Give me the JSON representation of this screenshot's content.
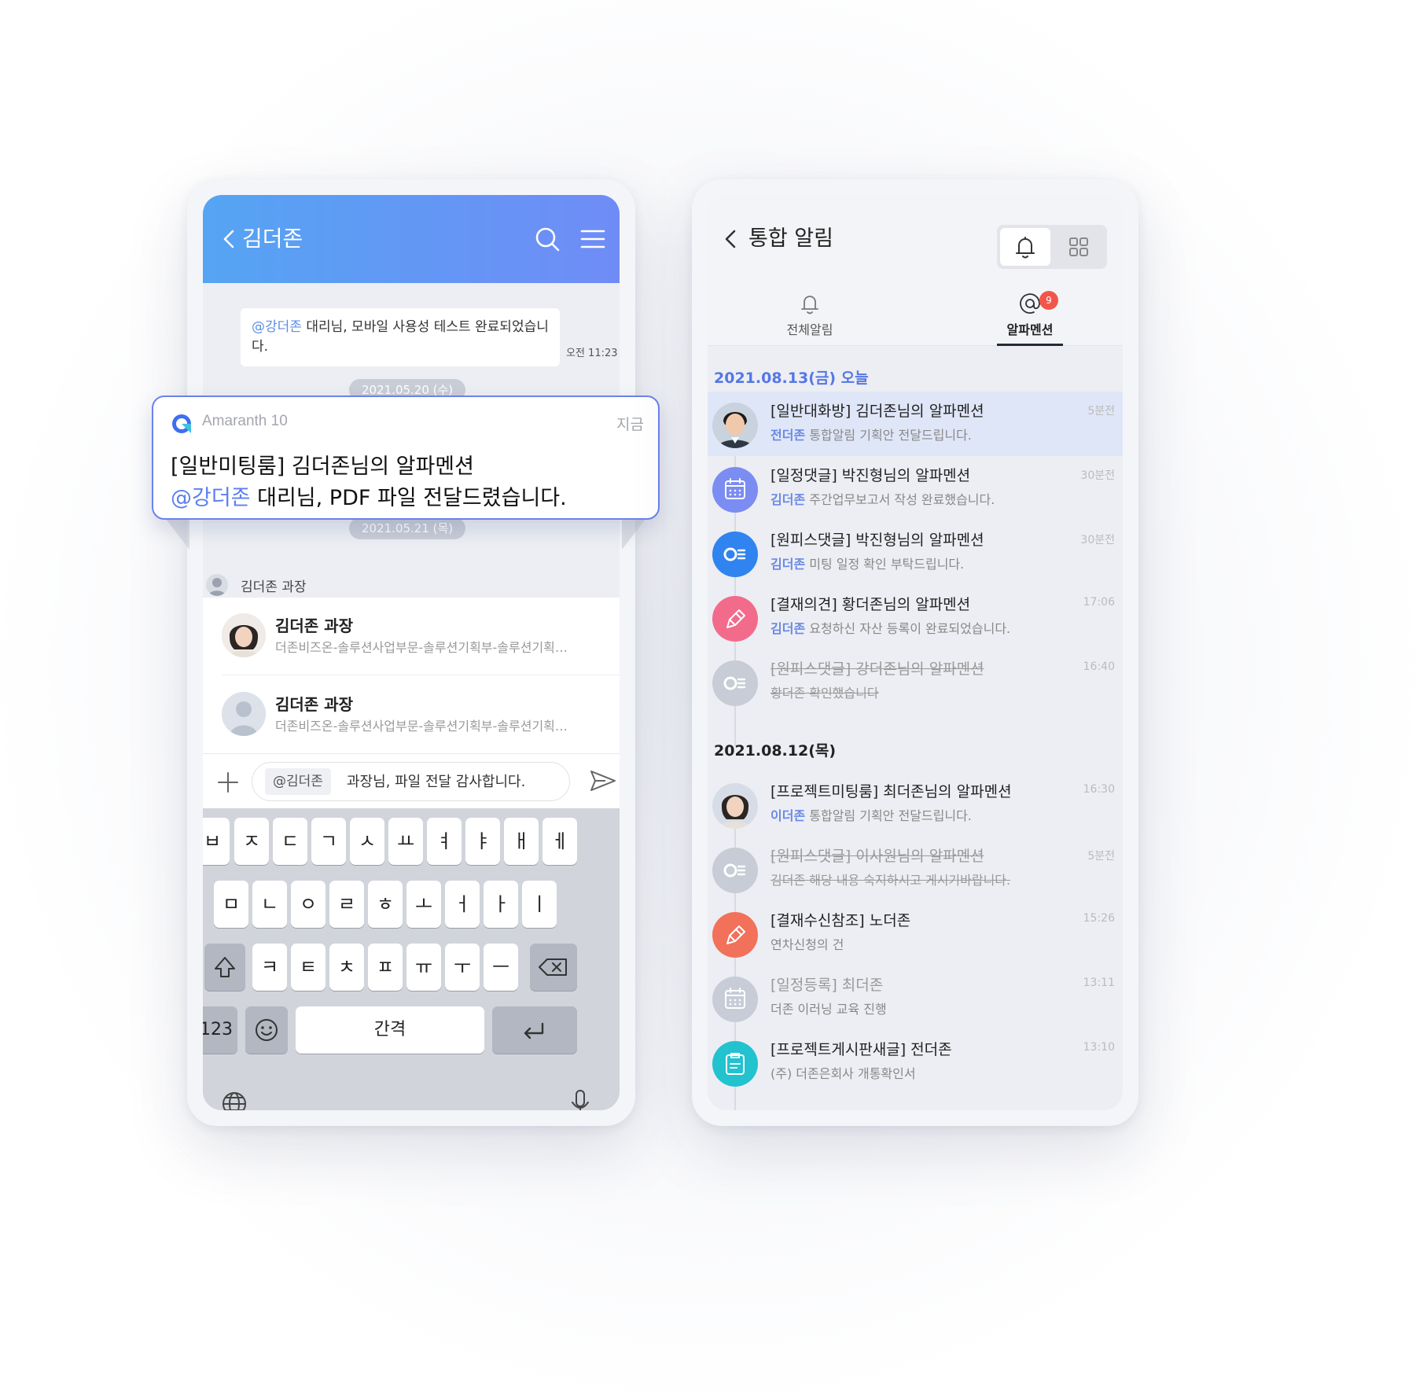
{
  "chat": {
    "title": "김더존",
    "message": {
      "mention": "@강더존",
      "text": " 대리님, 모바일 사용성 테스트 완료되었습니다.",
      "time": "오전 11:23"
    },
    "date_pill_1": "2021.05.20 (수)",
    "date_pill_2": "2021.05.21 (목)",
    "sender": "김더존 과장",
    "suggestions": [
      {
        "name": "김더존 과장",
        "dept": "더존비즈온-솔루션사업부문-솔루션기획부-솔루션기획…"
      },
      {
        "name": "김더존 과장",
        "dept": "더존비즈온-솔루션사업부문-솔루션기획부-솔루션기획…"
      }
    ],
    "input": {
      "mention_tag": "@김더존",
      "text": "과장님, 파일 전달 감사합니다."
    },
    "keyboard": {
      "row1": [
        "ㅂ",
        "ㅈ",
        "ㄷ",
        "ㄱ",
        "ㅅ",
        "ㅛ",
        "ㅕ",
        "ㅑ",
        "ㅐ",
        "ㅔ"
      ],
      "row2": [
        "ㅁ",
        "ㄴ",
        "ㅇ",
        "ㄹ",
        "ㅎ",
        "ㅗ",
        "ㅓ",
        "ㅏ",
        "ㅣ"
      ],
      "row3": [
        "ㅋ",
        "ㅌ",
        "ㅊ",
        "ㅍ",
        "ㅠ",
        "ㅜ",
        "ㅡ"
      ],
      "numbers_key": "123",
      "space_key": "간격"
    }
  },
  "notification": {
    "app": "Amaranth 10",
    "time": "지금",
    "title": "[일반미팅룸] 김더존님의 알파멘션",
    "mention": "@강더존",
    "body": " 대리님, PDF 파일 전달드렸습니다."
  },
  "inbox": {
    "title": "통합 알림",
    "tabs": [
      {
        "label": "전체알림"
      },
      {
        "label": "알파멘션",
        "badge": "9"
      }
    ],
    "groups": [
      {
        "date": "2021.08.13(금) 오늘",
        "items": [
          {
            "title": "[일반대화방] 김더존님의 알파멘션",
            "who": "전더존",
            "text": " 통합알림 기획안 전달드립니다.",
            "time": "5분전"
          },
          {
            "title": "[일정댓글] 박진형님의 알파멘션",
            "who": "김더존",
            "text": " 주간업무보고서 작성 완료했습니다.",
            "time": "30분전"
          },
          {
            "title": "[원피스댓글] 박진형님의 알파멘션",
            "who": "김더존",
            "text": " 미팅 일정 확인 부탁드립니다.",
            "time": "30분전"
          },
          {
            "title": "[결재의견] 황더존님의 알파멘션",
            "who": "김더존",
            "text": " 요청하신 자산 등록이 완료되었습니다.",
            "time": "17:06"
          },
          {
            "title": "[원피스댓글] 강더존님의 알파멘션",
            "who": "",
            "text": "황더존 확인했습니다",
            "time": "16:40"
          }
        ]
      },
      {
        "date": "2021.08.12(목)",
        "items": [
          {
            "title": "[프로젝트미팅룸] 최더존님의 알파멘션",
            "who": "이더존",
            "text": " 통합알림 기획안 전달드립니다.",
            "time": "16:30"
          },
          {
            "title": "[원피스댓글] 이사원님의 알파멘션",
            "who": "",
            "text": "김더존 해당 내용 숙지하시고 게시기바랍니다.",
            "time": "5분전"
          },
          {
            "title": "[결재수신참조] 노더존",
            "who": "",
            "text": "연차신청의 건",
            "time": "15:26"
          },
          {
            "title": "[일정등록] 최더존",
            "who": "",
            "text": "더존 이러닝 교육 진행",
            "time": "13:11"
          },
          {
            "title": "[프로젝트게시판새글] 전더존",
            "who": "",
            "text": "(주) 더존은회사 개통확인서",
            "time": "13:10"
          }
        ]
      }
    ]
  },
  "colors": {
    "header_gradient_start": "#55a4f3",
    "header_gradient_end": "#6f8cf6",
    "mention": "#5b7ff0",
    "badge": "#f2564a",
    "icon_calendar": "#7b8cf2",
    "icon_onepiece": "#2f84f0",
    "icon_approval": "#f26b8b",
    "icon_receipt": "#f2715a",
    "icon_board": "#22c2cf",
    "icon_inactive": "#c7ccd6"
  }
}
